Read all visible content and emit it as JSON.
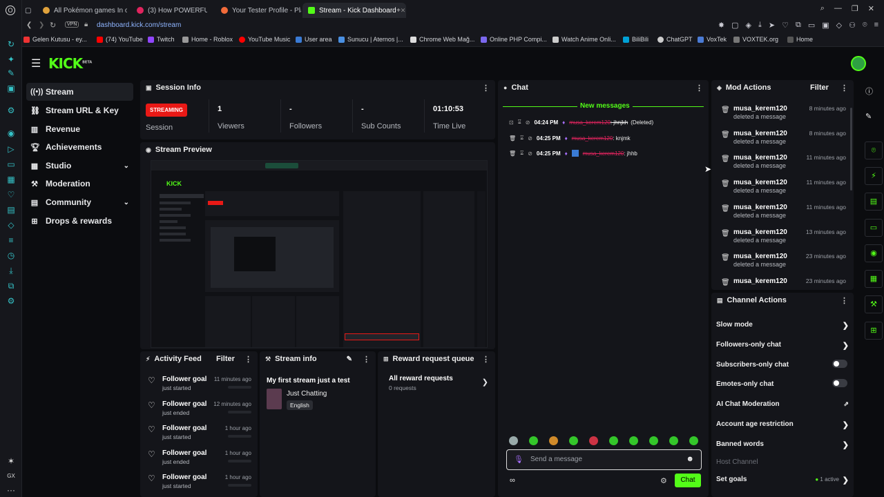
{
  "browser": {
    "tabs": [
      {
        "label": "All Pokémon games In ord",
        "color": "#e0a23c"
      },
      {
        "label": "(3) How POWERFUL Can",
        "color": "#e0245e"
      },
      {
        "label": "Your Tester Profile - Playt",
        "color": "#f26b3a"
      },
      {
        "label": "Stream - Kick Dashboard",
        "color": "#53fc18"
      }
    ],
    "url": "dashboard.kick.com/stream",
    "vpn": "VPN",
    "bookmarks": [
      "Gelen Kutusu - ey...",
      "(74) YouTube",
      "Twitch",
      "Home - Roblox",
      "YouTube Music",
      "User area",
      "Sunucu | Aternos |...",
      "Chrome Web Mağ...",
      "Online PHP Compi...",
      "Watch Anime Onli...",
      "BiliBili",
      "ChatGPT",
      "VoxTek",
      "VOXTEK.org",
      "Home"
    ]
  },
  "brand": {
    "logo": "KICK",
    "beta": "BETA",
    "accent": "#53fc18"
  },
  "nav": [
    {
      "label": "Stream",
      "icon": "broadcast-icon",
      "active": true
    },
    {
      "label": "Stream URL & Key",
      "icon": "link-icon"
    },
    {
      "label": "Revenue",
      "icon": "chart-icon"
    },
    {
      "label": "Achievements",
      "icon": "trophy-icon"
    },
    {
      "label": "Studio",
      "icon": "studio-icon",
      "expandable": true
    },
    {
      "label": "Moderation",
      "icon": "hammer-icon"
    },
    {
      "label": "Community",
      "icon": "community-icon",
      "expandable": true
    },
    {
      "label": "Drops & rewards",
      "icon": "gift-icon"
    }
  ],
  "session": {
    "title": "Session Info",
    "status": "STREAMING",
    "status_label": "Session",
    "viewers": "1",
    "viewers_label": "Viewers",
    "followers": "-",
    "followers_label": "Followers",
    "subs": "-",
    "subs_label": "Sub Counts",
    "time": "01:10:53",
    "time_label": "Time Live"
  },
  "preview": {
    "title": "Stream Preview"
  },
  "chat": {
    "title": "Chat",
    "new_messages": "New messages",
    "messages": [
      {
        "time": "04:24 PM",
        "user": "musa_kerem120",
        "text": ": jhnjkh",
        "note": "(Deleted)"
      },
      {
        "time": "04:25 PM",
        "user": "musa_kerem120",
        "text": ": knjmk",
        "note": ""
      },
      {
        "time": "04:25 PM",
        "user": "musa_kerem120",
        "text": ": jhhb",
        "note": ""
      }
    ],
    "placeholder": "Send a message",
    "send_label": "Chat"
  },
  "mod_actions": {
    "title": "Mod Actions",
    "filter": "Filter",
    "items": [
      {
        "user": "musa_kerem120",
        "action": "deleted a message",
        "time": "8 minutes ago"
      },
      {
        "user": "musa_kerem120",
        "action": "deleted a message",
        "time": "8 minutes ago"
      },
      {
        "user": "musa_kerem120",
        "action": "deleted a message",
        "time": "11 minutes ago"
      },
      {
        "user": "musa_kerem120",
        "action": "deleted a message",
        "time": "11 minutes ago"
      },
      {
        "user": "musa_kerem120",
        "action": "deleted a message",
        "time": "11 minutes ago"
      },
      {
        "user": "musa_kerem120",
        "action": "deleted a message",
        "time": "13 minutes ago"
      },
      {
        "user": "musa_kerem120",
        "action": "deleted a message",
        "time": "23 minutes ago"
      },
      {
        "user": "musa_kerem120",
        "action": "",
        "time": "23 minutes ago"
      }
    ]
  },
  "channel_actions": {
    "title": "Channel Actions",
    "slow": "Slow mode",
    "followers_only": "Followers-only chat",
    "subs_only": "Subscribers-only chat",
    "emotes_only": "Emotes-only chat",
    "ai_mod": "AI Chat Moderation",
    "age": "Account age restriction",
    "banned": "Banned words",
    "host": "Host Channel",
    "goals": "Set goals",
    "goals_active": "1 active"
  },
  "activity": {
    "title": "Activity Feed",
    "filter": "Filter",
    "items": [
      {
        "goal": "Follower goal",
        "status": "just started",
        "time": "11 minutes ago"
      },
      {
        "goal": "Follower goal",
        "status": "just ended",
        "time": "12 minutes ago"
      },
      {
        "goal": "Follower goal",
        "status": "just started",
        "time": "1 hour ago"
      },
      {
        "goal": "Follower goal",
        "status": "just ended",
        "time": "1 hour ago"
      },
      {
        "goal": "Follower goal",
        "status": "just started",
        "time": "1 hour ago"
      }
    ]
  },
  "stream_info": {
    "title": "Stream info",
    "stream_title": "My first stream just a test",
    "category": "Just Chatting",
    "language": "English"
  },
  "rewards": {
    "title": "Reward request queue",
    "all": "All reward requests",
    "count": "0 requests"
  }
}
